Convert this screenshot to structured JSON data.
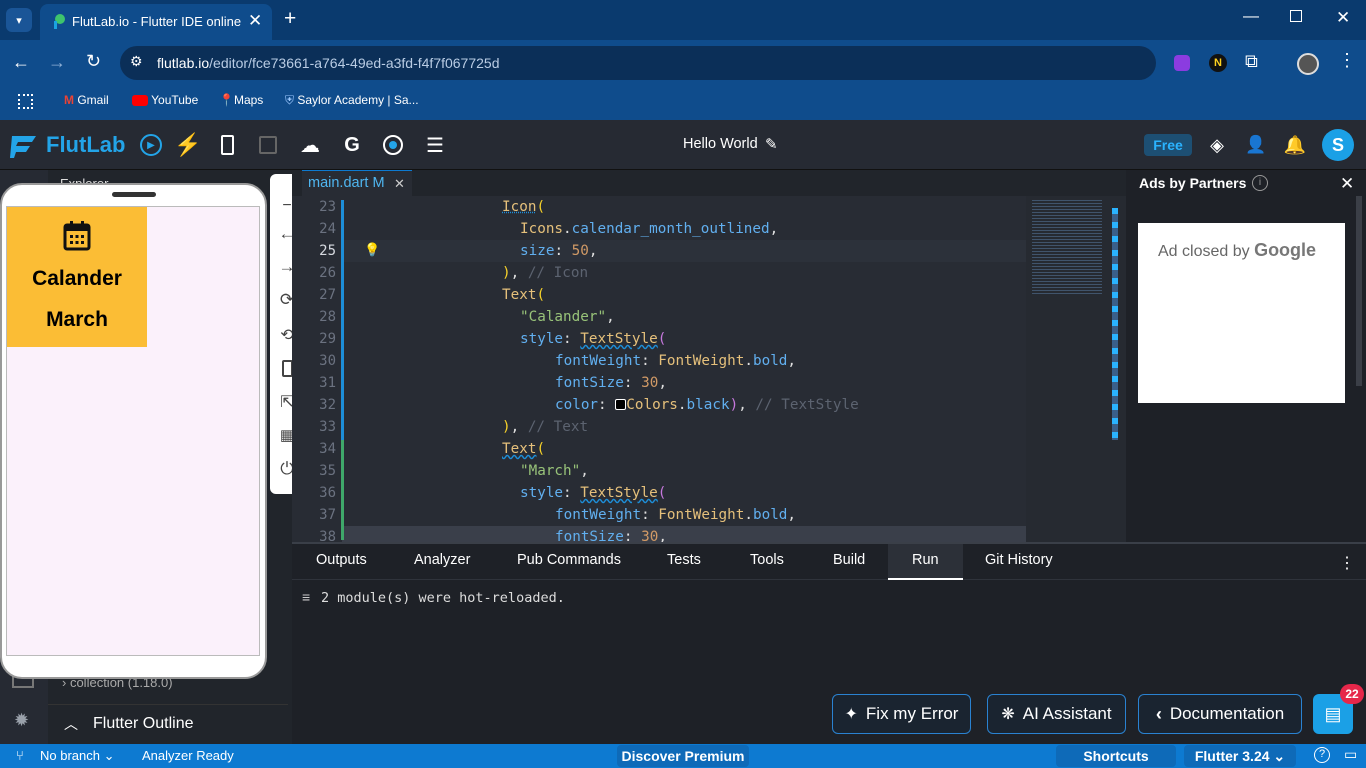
{
  "browser": {
    "tab_title": "FlutLab.io - Flutter IDE online",
    "url_host": "flutlab.io",
    "url_path": "/editor/fce73661-a764-49ed-a3fd-f4f7f067725d",
    "bookmarks": [
      "Gmail",
      "YouTube",
      "Maps",
      "Saylor Academy | Sa..."
    ]
  },
  "app": {
    "logo_text": "FlutLab",
    "project_title": "Hello World",
    "plan_badge": "Free",
    "avatar_letter": "S"
  },
  "sidebar": {
    "explorer_label": "Explorer",
    "collection_item": "collection (1.18.0)",
    "outline_label": "Flutter Outline"
  },
  "preview": {
    "card_title": "Calander",
    "card_subtitle": "March"
  },
  "editor": {
    "tab_label": "main.dart M",
    "line_numbers": [
      "23",
      "24",
      "25",
      "26",
      "27",
      "28",
      "29",
      "30",
      "31",
      "32",
      "33",
      "34",
      "35",
      "36",
      "37",
      "38"
    ]
  },
  "ads": {
    "title": "Ads by Partners",
    "closed_text": "Ad closed by",
    "google_text": "Google"
  },
  "bottom": {
    "tabs": [
      "Outputs",
      "Analyzer",
      "Pub Commands",
      "Tests",
      "Tools",
      "Build",
      "Run",
      "Git History"
    ],
    "active_tab": "Run",
    "output_line": "2 module(s) were hot-reloaded.",
    "fix_error": "Fix my Error",
    "ai_assistant": "AI Assistant",
    "documentation": "Documentation",
    "chat_badge": "22"
  },
  "status": {
    "branch": "No branch",
    "analyzer": "Analyzer Ready",
    "premium": "Discover Premium",
    "shortcuts": "Shortcuts",
    "flutter_version": "Flutter 3.24"
  },
  "colors": {
    "accent": "#0d7ad1",
    "card": "#fbbd35",
    "editor_bg": "#282c34"
  }
}
